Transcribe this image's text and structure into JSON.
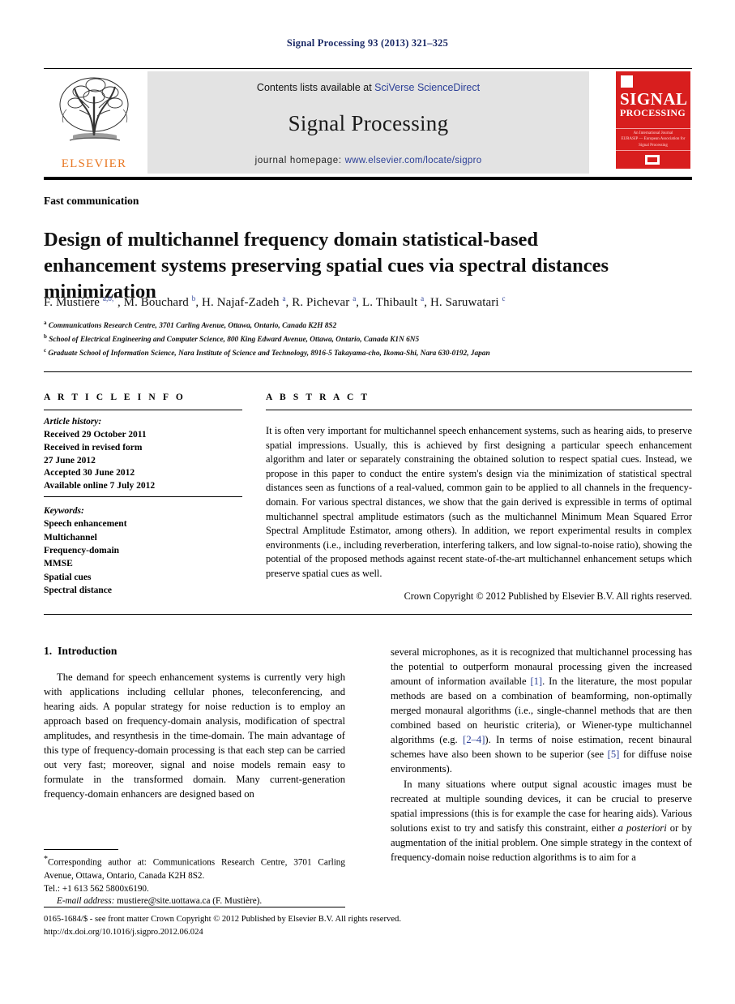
{
  "running_head": "Signal Processing 93 (2013) 321–325",
  "masthead": {
    "contents_prefix": "Contents lists available at ",
    "contents_link": "SciVerse ScienceDirect",
    "journal_title": "Signal Processing",
    "homepage_label": "journal homepage: ",
    "homepage_link": "www.elsevier.com/locate/sigpro",
    "publisher_wordmark": "ELSEVIER",
    "cover": {
      "line1": "SIGNAL",
      "line2": "PROCESSING",
      "subtitle": "An International Journal",
      "subtitle2": "EURASIP — European Association for Signal Processing"
    }
  },
  "colors": {
    "link_blue": "#2b3f97",
    "running_head_blue": "#1b2a66",
    "elsevier_orange": "#e87722",
    "cover_red": "#d81e1e",
    "masthead_gray": "#e3e3e3"
  },
  "article_type": "Fast communication",
  "title": "Design of multichannel frequency domain statistical-based enhancement systems preserving spatial cues via spectral distances minimization",
  "authors_html": "F. Mustière <sup>a,b,</sup><sup class=\"ast\">*</sup>, M. Bouchard <sup>b</sup>, H. Najaf-Zadeh <sup>a</sup>, R. Pichevar <sup>a</sup>, L. Thibault <sup>a</sup>, H. Saruwatari <sup>c</sup>",
  "affiliations": [
    {
      "marker": "a",
      "text": "Communications Research Centre, 3701 Carling Avenue, Ottawa, Ontario, Canada K2H 8S2"
    },
    {
      "marker": "b",
      "text": "School of Electrical Engineering and Computer Science, 800 King Edward Avenue, Ottawa, Ontario, Canada K1N 6N5"
    },
    {
      "marker": "c",
      "text": "Graduate School of Information Science, Nara Institute of Science and Technology, 8916-5 Takayama-cho, Ikoma-Shi, Nara 630-0192, Japan"
    }
  ],
  "article_info": {
    "heading": "A R T I C L E  I N F O",
    "history_label": "Article history:",
    "history": [
      "Received 29 October 2011",
      "Received in revised form",
      "27 June 2012",
      "Accepted 30 June 2012",
      "Available online 7 July 2012"
    ],
    "keywords_label": "Keywords:",
    "keywords": [
      "Speech enhancement",
      "Multichannel",
      "Frequency-domain",
      "MMSE",
      "Spatial cues",
      "Spectral distance"
    ]
  },
  "abstract": {
    "heading": "A B S T R A C T",
    "text": "It is often very important for multichannel speech enhancement systems, such as hearing aids, to preserve spatial impressions. Usually, this is achieved by first designing a particular speech enhancement algorithm and later or separately constraining the obtained solution to respect spatial cues. Instead, we propose in this paper to conduct the entire system's design via the minimization of statistical spectral distances seen as functions of a real-valued, common gain to be applied to all channels in the frequency-domain. For various spectral distances, we show that the gain derived is expressible in terms of optimal multichannel spectral amplitude estimators (such as the multichannel Minimum Mean Squared Error Spectral Amplitude Estimator, among others). In addition, we report experimental results in complex environments (i.e., including reverberation, interfering talkers, and low signal-to-noise ratio), showing the potential of the proposed methods against recent state-of-the-art multichannel enhancement setups which preserve spatial cues as well.",
    "copyright": "Crown Copyright © 2012 Published by Elsevier B.V. All rights reserved."
  },
  "body": {
    "section_number": "1.",
    "section_title": "Introduction",
    "left_paragraph_1": "The demand for speech enhancement systems is currently very high with applications including cellular phones, teleconferencing, and hearing aids. A popular strategy for noise reduction is to employ an approach based on frequency-domain analysis, modification of spectral amplitudes, and resynthesis in the time-domain. The main advantage of this type of frequency-domain processing is that each step can be carried out very fast; moreover, signal and noise models remain easy to formulate in the transformed domain. Many current-generation frequency-domain enhancers are designed based on",
    "right_paragraph_1_a": "several microphones, as it is recognized that multichannel processing has the potential to outperform monaural processing given the increased amount of information available ",
    "right_cite_1": "[1]",
    "right_paragraph_1_b": ". In the literature, the most popular methods are based on a combination of beamforming, non-optimally merged monaural algorithms (i.e., single-channel methods that are then combined based on heuristic criteria), or Wiener-type multichannel algorithms (e.g. ",
    "right_cite_2": "[2–4]",
    "right_paragraph_1_c": "). In terms of noise estimation, recent binaural schemes have also been shown to be superior (see ",
    "right_cite_3": "[5]",
    "right_paragraph_1_d": " for diffuse noise environments).",
    "right_paragraph_2_a": "In many situations where output signal acoustic images must be recreated at multiple sounding devices, it can be crucial to preserve spatial impressions (this is for example the case for hearing aids). Various solutions exist to try and satisfy this constraint, either ",
    "right_paragraph_2_italic": "a posteriori",
    "right_paragraph_2_b": " or by augmentation of the initial problem. One simple strategy in the context of frequency-domain noise reduction algorithms is to aim for a"
  },
  "footnote": {
    "corresponding": "Corresponding author at: Communications Research Centre, 3701 Carling Avenue, Ottawa, Ontario, Canada K2H 8S2.",
    "tel": "Tel.: +1 613 562 5800x6190.",
    "email_label": "E-mail address:",
    "email": "mustiere@site.uottawa.ca (F. Mustière)."
  },
  "bottom": {
    "issn_line": "0165-1684/$ - see front matter Crown Copyright © 2012 Published by Elsevier B.V. All rights reserved.",
    "doi_line": "http://dx.doi.org/10.1016/j.sigpro.2012.06.024"
  }
}
